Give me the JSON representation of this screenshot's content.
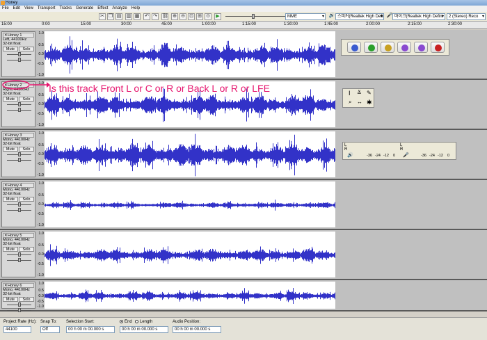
{
  "window": {
    "title": "Honey"
  },
  "menu": [
    "File",
    "Edit",
    "View",
    "Transport",
    "Tracks",
    "Generate",
    "Effect",
    "Analyze",
    "Help"
  ],
  "devices": {
    "host": "MME",
    "output": "스피커(Realtek High Definit",
    "input": "마이크(Realtek High Defini",
    "channels": "2 (Stereo) Reco"
  },
  "ruler": {
    "ticks": [
      "15:00",
      "0:00",
      "15:00",
      "30:00",
      "45:00",
      "1:00:00",
      "1:15:00",
      "1:30:00",
      "1:45:00",
      "2:00:00",
      "2:15:00",
      "2:30:00"
    ]
  },
  "tracks": [
    {
      "name": "Honey 1",
      "info1": "Left, 44100Hz",
      "info2": "32-bit float",
      "mute": "Mute",
      "solo": "Solo"
    },
    {
      "name": "Honey 2",
      "info1": "Right, 44100Hz",
      "info2": "32-bit float",
      "mute": "Mute",
      "solo": "Solo"
    },
    {
      "name": "Honey 3",
      "info1": "Mono, 44100Hz",
      "info2": "32-bit float",
      "mute": "Mute",
      "solo": "Solo"
    },
    {
      "name": "Honey 4",
      "info1": "Mono, 44100Hz",
      "info2": "32-bit float",
      "mute": "Mute",
      "solo": "Solo"
    },
    {
      "name": "Honey 5",
      "info1": "Mono, 44100Hz",
      "info2": "32-bit float",
      "mute": "Mute",
      "solo": "Solo"
    },
    {
      "name": "Honey 6",
      "info1": "Mono, 44100Hz",
      "info2": "32-bit float",
      "mute": "Mute",
      "solo": "Solo"
    }
  ],
  "scale": {
    "top": "1.0",
    "upper": "0.5",
    "zero": "0.0",
    "lower": "-0.5",
    "bottom": "-1.0"
  },
  "annotation": "Is this track Front L or C or R or Back L or R or LFE",
  "meter": {
    "l": "L",
    "r": "R",
    "ticks": [
      "-36",
      "-24",
      "-12",
      "0"
    ]
  },
  "status": {
    "project_rate_label": "Project Rate (Hz):",
    "project_rate": "44100",
    "snap_label": "Snap To:",
    "snap_value": "Off",
    "selection_start_label": "Selection Start:",
    "end_label": "End",
    "length_label": "Length",
    "audio_position_label": "Audio Position:",
    "time_value": "00 h 00 m 00.000 s"
  },
  "colors": {
    "wave": "#3232c8",
    "annotation": "#e6156e"
  }
}
